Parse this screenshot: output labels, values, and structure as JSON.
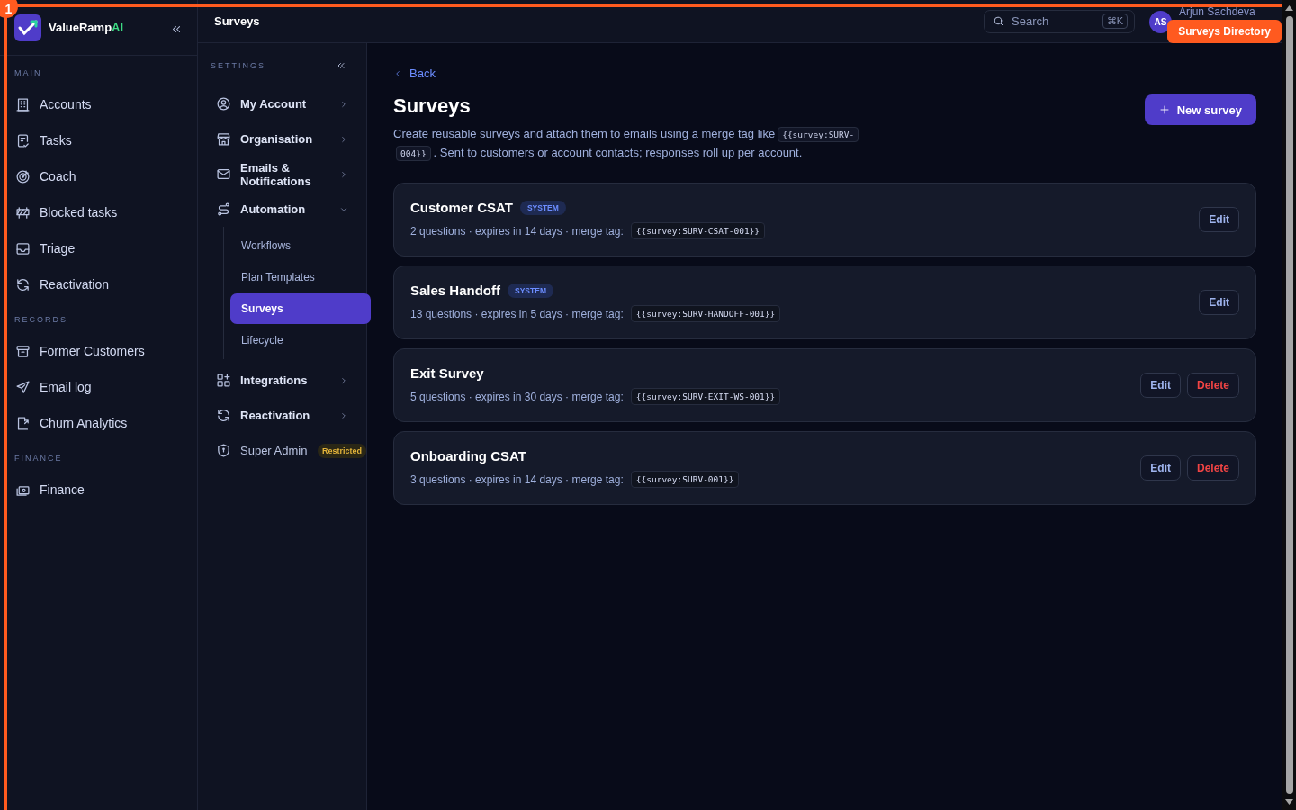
{
  "app": {
    "name": "ValueRamp",
    "name_accent": "AI"
  },
  "sidebar": {
    "sections": [
      {
        "title": "MAIN",
        "items": [
          {
            "label": "Accounts"
          },
          {
            "label": "Tasks"
          },
          {
            "label": "Coach"
          },
          {
            "label": "Blocked tasks"
          },
          {
            "label": "Triage"
          },
          {
            "label": "Reactivation"
          }
        ]
      },
      {
        "title": "RECORDS",
        "items": [
          {
            "label": "Former Customers"
          },
          {
            "label": "Email log"
          },
          {
            "label": "Churn Analytics"
          }
        ]
      },
      {
        "title": "FINANCE",
        "items": [
          {
            "label": "Finance"
          }
        ]
      }
    ]
  },
  "topbar": {
    "title": "Surveys",
    "search": {
      "placeholder": "Search",
      "shortcut": "⌘K"
    },
    "user": {
      "initials": "AS",
      "name": "Arjun Sachdeva"
    }
  },
  "settings": {
    "title": "SETTINGS",
    "items": [
      {
        "label": "My Account",
        "kind": "link"
      },
      {
        "label": "Organisation",
        "kind": "link"
      },
      {
        "label": "Emails & Notifications",
        "kind": "link"
      },
      {
        "label": "Automation",
        "kind": "group",
        "expanded": true,
        "children": [
          {
            "label": "Workflows",
            "selected": false
          },
          {
            "label": "Plan Templates",
            "selected": false
          },
          {
            "label": "Surveys",
            "selected": true
          },
          {
            "label": "Lifecycle",
            "selected": false
          }
        ]
      },
      {
        "label": "Integrations",
        "kind": "link"
      },
      {
        "label": "Reactivation",
        "kind": "link"
      },
      {
        "label": "Super Admin",
        "kind": "restricted",
        "badge": "Restricted"
      }
    ]
  },
  "page": {
    "back": "Back",
    "title": "Surveys",
    "description_before": "Create reusable surveys and attach them to emails using a merge tag like",
    "description_code_lines": [
      "{{survey:SURV-",
      "004}}"
    ],
    "description_after": ". Sent to customers or account contacts; responses roll up per account.",
    "new_button": "New survey"
  },
  "surveys": [
    {
      "name": "Customer CSAT",
      "badge": "SYSTEM",
      "meta": "2 questions · expires in 14 days · merge tag:",
      "tag": "{{survey:SURV-CSAT-001}}",
      "actions": [
        {
          "label": "Edit",
          "kind": "edit"
        }
      ]
    },
    {
      "name": "Sales Handoff",
      "badge": "SYSTEM",
      "meta": "13 questions · expires in 5 days · merge tag:",
      "tag": "{{survey:SURV-HANDOFF-001}}",
      "actions": [
        {
          "label": "Edit",
          "kind": "edit"
        }
      ]
    },
    {
      "name": "Exit Survey",
      "meta": "5 questions · expires in 30 days · merge tag:",
      "tag": "{{survey:SURV-EXIT-WS-001}}",
      "actions": [
        {
          "label": "Edit",
          "kind": "edit"
        },
        {
          "label": "Delete",
          "kind": "delete"
        }
      ]
    },
    {
      "name": "Onboarding CSAT",
      "meta": "3 questions · expires in 14 days · merge tag:",
      "tag": "{{survey:SURV-001}}",
      "actions": [
        {
          "label": "Edit",
          "kind": "edit"
        },
        {
          "label": "Delete",
          "kind": "delete"
        }
      ]
    }
  ],
  "annotation": {
    "badge": "1",
    "label": "Surveys Directory"
  }
}
